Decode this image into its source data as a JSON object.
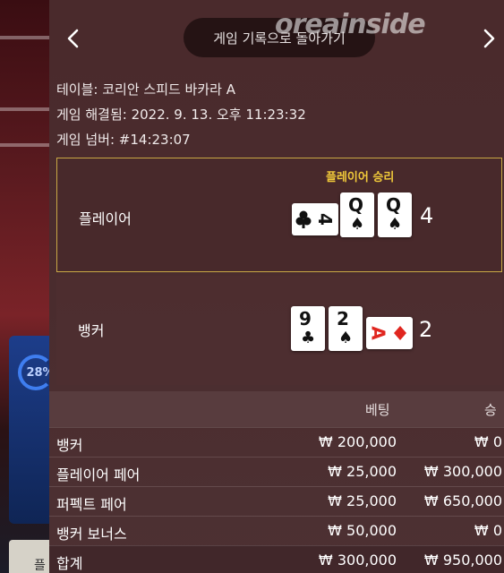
{
  "header": {
    "back_icon": "chevron-left-icon",
    "forward_icon": "chevron-right-icon",
    "history_button_label": "게임 기록으로 돌아가기",
    "watermark": "oreainside"
  },
  "info": {
    "table": "테이블: 코리안 스피드 바카라 A",
    "resolved": "게임 해결됨: 2022. 9. 13. 오후 11:23:32",
    "game_number": "게임 넘버: #14:23:07"
  },
  "result": {
    "winner_label": "플레이어 승리",
    "player": {
      "label": "플레이어",
      "score": "4",
      "cards": [
        {
          "rank": "4",
          "suit": "♣",
          "orientation": "sideways",
          "color": "#111111"
        },
        {
          "rank": "Q",
          "suit": "♠",
          "orientation": "upright",
          "color": "#111111"
        },
        {
          "rank": "Q",
          "suit": "♠",
          "orientation": "upright",
          "color": "#111111"
        }
      ]
    },
    "banker": {
      "label": "뱅커",
      "score": "2",
      "cards": [
        {
          "rank": "9",
          "suit": "♣",
          "orientation": "upright",
          "color": "#111111"
        },
        {
          "rank": "2",
          "suit": "♠",
          "orientation": "upright",
          "color": "#111111"
        },
        {
          "rank": "A",
          "suit": "♦",
          "orientation": "sideways",
          "color": "#e0261f"
        }
      ]
    }
  },
  "bets": {
    "columns": {
      "bet": "베팅",
      "win": "승"
    },
    "rows": [
      {
        "name": "뱅커",
        "bet": "₩ 200,000",
        "win": "₩ 0"
      },
      {
        "name": "플레이어 페어",
        "bet": "₩ 25,000",
        "win": "₩ 300,000"
      },
      {
        "name": "퍼펙트 페어",
        "bet": "₩ 25,000",
        "win": "₩ 650,000"
      },
      {
        "name": "뱅커 보너스",
        "bet": "₩ 50,000",
        "win": "₩ 0"
      }
    ],
    "total": {
      "name": "합계",
      "bet": "₩ 300,000",
      "win": "₩ 950,000"
    }
  },
  "background": {
    "progress_percent": "28%",
    "bottom_button_label": "플"
  },
  "colors": {
    "accent_gold": "#f0c93a",
    "panel_bg": "#4a2a2c",
    "red_suit": "#e0261f"
  }
}
